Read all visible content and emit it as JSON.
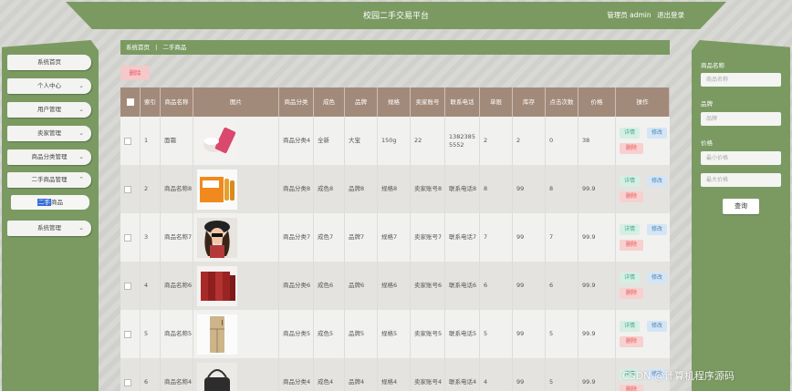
{
  "header": {
    "title": "校园二手交易平台",
    "role": "管理员 admin",
    "logout": "退出登录"
  },
  "sidebar": {
    "items": [
      {
        "label": "系统首页",
        "chev": ""
      },
      {
        "label": "个人中心",
        "chev": "⌄"
      },
      {
        "label": "用户管理",
        "chev": "⌄"
      },
      {
        "label": "卖家管理",
        "chev": "⌄"
      },
      {
        "label": "商品分类管理",
        "chev": "⌄"
      },
      {
        "label": "二手商品管理",
        "chev": "⌃"
      },
      {
        "label": "系统管理",
        "chev": "⌄"
      }
    ],
    "sub": {
      "hl": "二手",
      "rest": "商品"
    }
  },
  "breadcrumb": {
    "home": "系统首页",
    "sep": "|",
    "current": "二手商品"
  },
  "toolbar": {
    "delete_label": "删除"
  },
  "table": {
    "headers": [
      "",
      "索引",
      "商品名称",
      "图片",
      "商品分类",
      "成色",
      "品牌",
      "规格",
      "卖家账号",
      "联系电话",
      "单限",
      "库存",
      "点击次数",
      "价格",
      "操作"
    ],
    "rows": [
      {
        "idx": "1",
        "name": "面霜",
        "cat": "商品分类4",
        "cond": "全新",
        "brand": "大宝",
        "spec": "150g",
        "seller": "22",
        "phone": "13823855552",
        "limit": "2",
        "stock": "2",
        "clicks": "0",
        "price": "38",
        "img": "cream"
      },
      {
        "idx": "2",
        "name": "商品名称8",
        "cat": "商品分类8",
        "cond": "成色8",
        "brand": "品牌8",
        "spec": "规格8",
        "seller": "卖家账号8",
        "phone": "联系电话8",
        "limit": "8",
        "stock": "99",
        "clicks": "8",
        "price": "99.9",
        "img": "box"
      },
      {
        "idx": "3",
        "name": "商品名称7",
        "cat": "商品分类7",
        "cond": "成色7",
        "brand": "品牌7",
        "spec": "规格7",
        "seller": "卖家账号7",
        "phone": "联系电话7",
        "limit": "7",
        "stock": "99",
        "clicks": "7",
        "price": "99.9",
        "img": "girl"
      },
      {
        "idx": "4",
        "name": "商品名称6",
        "cat": "商品分类6",
        "cond": "成色6",
        "brand": "品牌6",
        "spec": "规格6",
        "seller": "卖家账号6",
        "phone": "联系电话6",
        "limit": "6",
        "stock": "99",
        "clicks": "6",
        "price": "99.9",
        "img": "books"
      },
      {
        "idx": "5",
        "name": "商品名称5",
        "cat": "商品分类5",
        "cond": "成色5",
        "brand": "品牌5",
        "spec": "规格5",
        "seller": "卖家账号5",
        "phone": "联系电话5",
        "limit": "5",
        "stock": "99",
        "clicks": "5",
        "price": "99.9",
        "img": "fridge"
      },
      {
        "idx": "6",
        "name": "商品名称4",
        "cat": "商品分类4",
        "cond": "成色4",
        "brand": "品牌4",
        "spec": "规格4",
        "seller": "卖家账号4",
        "phone": "联系电话4",
        "limit": "4",
        "stock": "99",
        "clicks": "5",
        "price": "99.9",
        "img": "bag"
      }
    ],
    "ops": {
      "detail": "详情",
      "edit": "修改",
      "delete": "删除"
    }
  },
  "search": {
    "name_label": "商品名称",
    "name_placeholder": "商品名称",
    "brand_label": "品牌",
    "brand_placeholder": "品牌",
    "price_label": "价格",
    "min_placeholder": "最小价格",
    "max_placeholder": "最大价格",
    "query_label": "查询"
  },
  "watermark": "CSDN @计算机程序源码",
  "colors": {
    "accent": "#7a9a62",
    "header_row": "#a28a7a",
    "danger": "#e55"
  }
}
